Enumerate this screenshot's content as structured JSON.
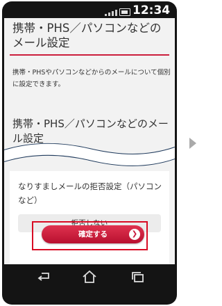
{
  "status_bar": {
    "time": "12:34",
    "signal_icon": "signal-icon",
    "battery_icon": "battery-icon"
  },
  "page": {
    "title": "携帯・PHS／パソコンなどのメール設定",
    "description": "携帯・PHSやパソコンなどからのメールについて個別に設定できます。",
    "section_title": "携帯・PHS／パソコンなどのメール設定"
  },
  "card": {
    "option_label": "なりすましメールの拒否設定（パソコンなど）",
    "option_value": "拒否しない",
    "confirm_label": "確定する"
  },
  "nav": {
    "icons": [
      "back-icon",
      "home-icon",
      "recent-apps-icon"
    ]
  },
  "colors": {
    "accent": "#cc1e3c",
    "highlight": "#d80c24"
  }
}
